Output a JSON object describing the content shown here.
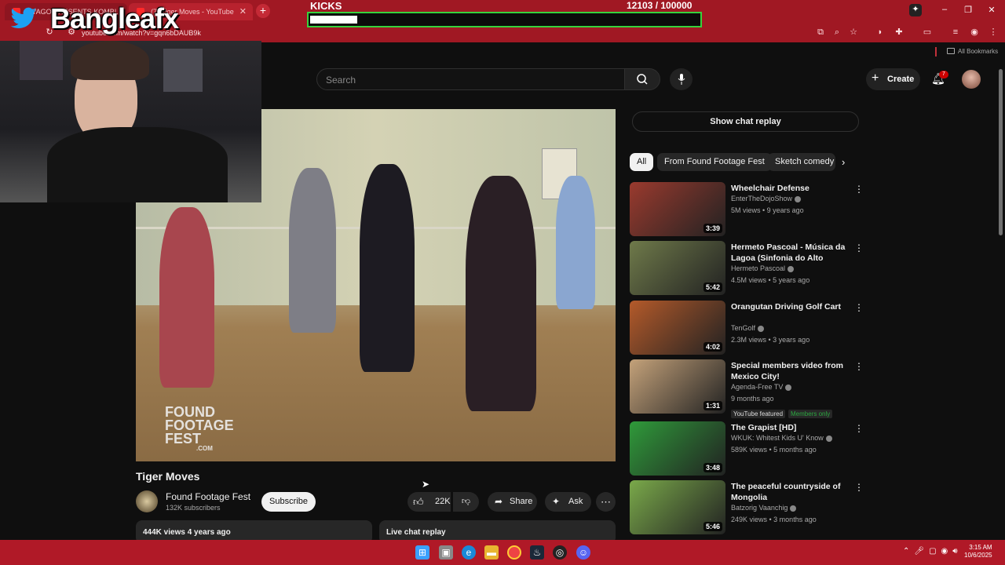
{
  "browser": {
    "tabs": [
      {
        "label": "RYAGO PRESENTS KOMBI..."
      },
      {
        "label": "(7) Tiger Moves - YouTube"
      }
    ],
    "url": "youtube.com/watch?v=gqn6bDAUB9k",
    "bookmarks_label": "All Bookmarks"
  },
  "overlay": {
    "kicks_title": "KICKS",
    "kicks_count": "12103  / 100000",
    "kicks_progress": 0.121,
    "streamer_name": "Bangleafx"
  },
  "header": {
    "search_placeholder": "Search",
    "create_label": "Create",
    "notification_count": "7"
  },
  "video": {
    "watermark": "FOUND FOOTAGE FEST",
    "watermark_suffix": ".COM",
    "title": "Tiger Moves",
    "channel": "Found Footage Fest",
    "subscribers": "132K subscribers",
    "subscribe_label": "Subscribe",
    "likes": "22K",
    "share_label": "Share",
    "ask_label": "Ask",
    "views_line": "444K views  4 years ago",
    "live_chat_label": "Live chat replay"
  },
  "sidebar": {
    "chat_replay_label": "Show chat replay",
    "chips": [
      {
        "label": "All"
      },
      {
        "label": "From Found Footage Fest"
      },
      {
        "label": "Sketch comedy"
      }
    ],
    "recommendations": [
      {
        "title": "Wheelchair Defense",
        "channel": "EnterTheDojoShow",
        "meta": "5M views • 9 years ago",
        "duration": "3:39",
        "thumb_color": "#9a3a2e"
      },
      {
        "title": "Hermeto Pascoal - Música da Lagoa (Sinfonia do Alto Ribeir...",
        "channel": "Hermeto Pascoal",
        "meta": "4.5M views • 5 years ago",
        "duration": "5:42",
        "thumb_color": "#6f7a4a"
      },
      {
        "title": "Orangutan Driving Golf Cart",
        "channel": "TenGolf",
        "meta": "2.3M views • 3 years ago",
        "duration": "4:02",
        "thumb_color": "#b45a2a"
      },
      {
        "title": "Special members video from Mexico City!",
        "channel": "Agenda-Free TV",
        "meta": "9 months ago",
        "duration": "1:31",
        "thumb_color": "#c4a27a",
        "tags": [
          "YouTube featured",
          "Members only"
        ]
      },
      {
        "title": "The Grapist [HD]",
        "channel": "WKUK: Whitest Kids U' Know",
        "meta": "589K views • 5 months ago",
        "duration": "3:48",
        "thumb_color": "#2f9a3a"
      },
      {
        "title": "The peaceful countryside of Mongolia",
        "channel": "Batzorig Vaanchig",
        "meta": "249K views • 3 months ago",
        "duration": "5:46",
        "thumb_color": "#7aa94a"
      }
    ]
  },
  "taskbar": {
    "time": "3:15 AM",
    "date": "10/6/2025"
  },
  "colors": {
    "browser_chrome": "#a01823",
    "taskbar": "#b01927",
    "progress_border": "#37d13d",
    "members_green": "#2ba640"
  }
}
